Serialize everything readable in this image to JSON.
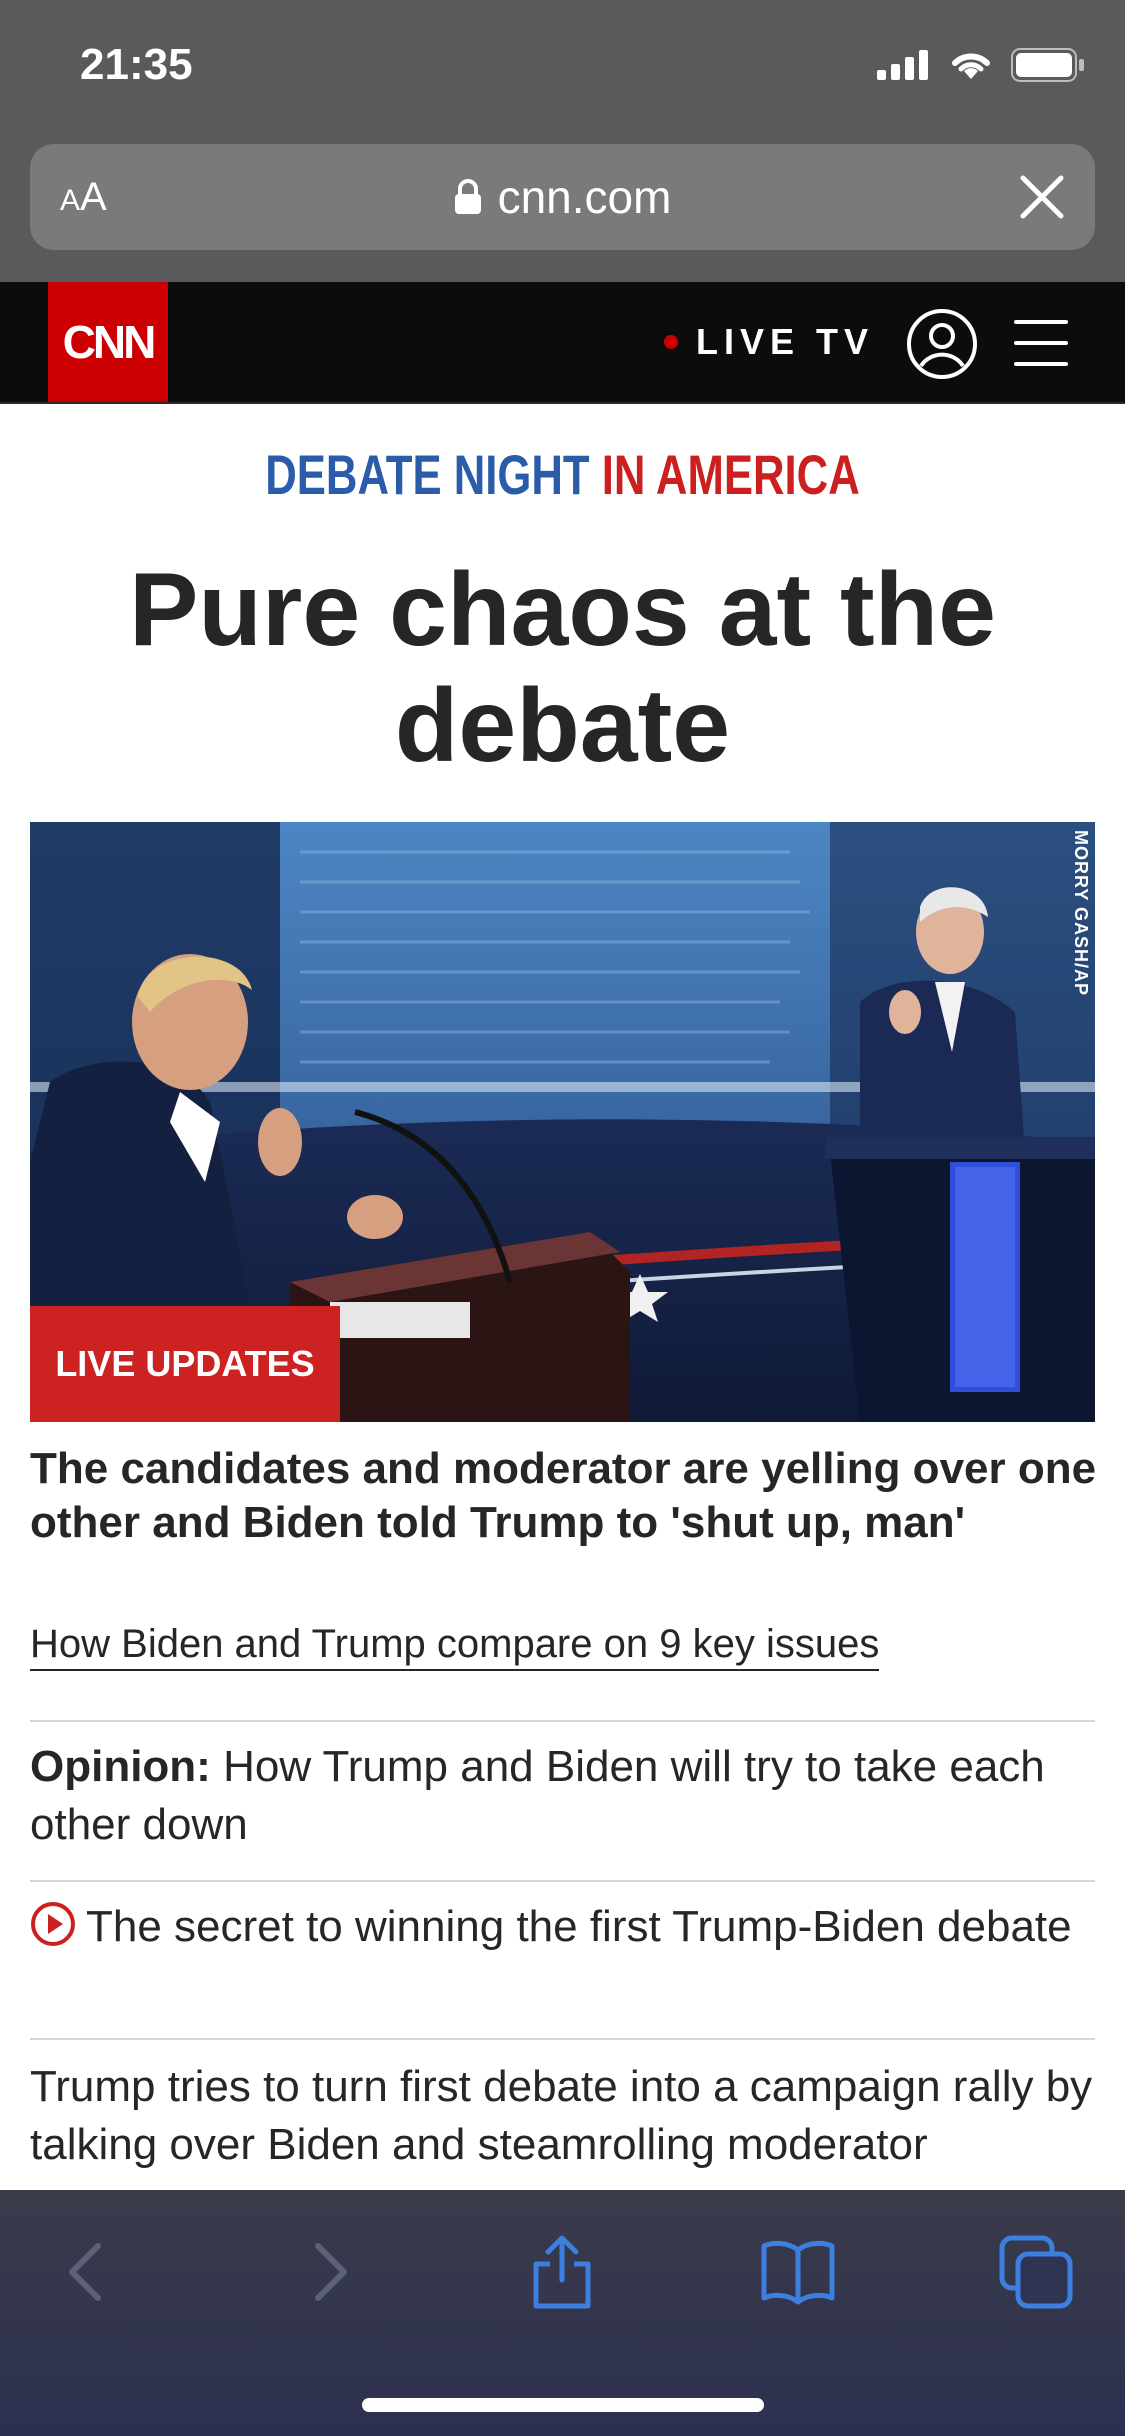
{
  "status_bar": {
    "time": "21:35"
  },
  "browser": {
    "text_size_label_small": "A",
    "text_size_label_large": "A",
    "url": "cnn.com"
  },
  "cnn_header": {
    "logo_text": "CNN",
    "live_tv_label": "LIVE TV"
  },
  "article": {
    "kicker_part1": "DEBATE NIGHT",
    "kicker_part2": " IN AMERICA",
    "headline": "Pure chaos at the debate",
    "image_badge": "LIVE UPDATES",
    "image_credit": "MORRY GASH/AP",
    "lead": "The candidates and moderator are yelling over one other and Biden told Trump to 'shut up, man'",
    "sublink": "How Biden and Trump compare on 9 key issues"
  },
  "stories": [
    {
      "prefix": "Opinion:",
      "text": " How Trump and Biden will try to take each other down"
    },
    {
      "text": "The secret to winning the first Trump-Biden debate"
    },
    {
      "text": "Trump tries to turn first debate into a campaign rally by talking over Biden and steamrolling moderator"
    }
  ],
  "colors": {
    "cnn_red": "#cc0000",
    "kicker_blue": "#2a5caa",
    "kicker_red": "#cc1f1f",
    "toolbar_blue": "#3d7fe0"
  },
  "icons": {
    "lock": "lock-icon",
    "close": "close-icon",
    "account": "account-icon",
    "menu": "hamburger-menu-icon",
    "play": "play-circle-icon",
    "back": "chevron-left-icon",
    "forward": "chevron-right-icon",
    "share": "share-icon",
    "bookmarks": "book-icon",
    "tabs": "tabs-icon"
  }
}
